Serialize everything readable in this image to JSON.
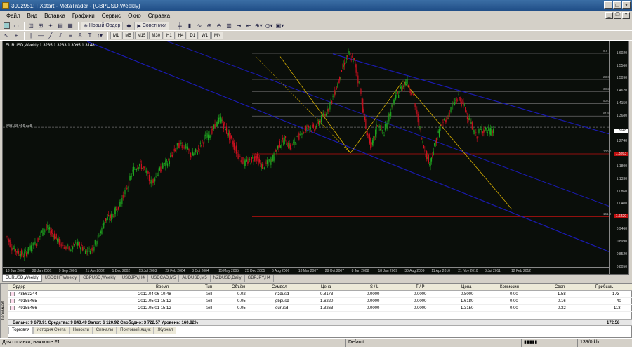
{
  "window": {
    "title": "3002951: FXstart - MetaTrader - [GBPUSD,Weekly]"
  },
  "menu": [
    "Файл",
    "Вид",
    "Вставка",
    "Графики",
    "Сервис",
    "Окно",
    "Справка"
  ],
  "toolbar": {
    "new_order": "Новый Ордер",
    "experts": "Советники"
  },
  "timeframes": [
    "M1",
    "M5",
    "M15",
    "M30",
    "H1",
    "H4",
    "D1",
    "W1",
    "MN"
  ],
  "chart": {
    "title": "EURUSD,Weekly  1.3235 1.3283 1.3095 1.3148",
    "order_label": "#49155466 sell",
    "current_price": "1.3148",
    "line_tags": [
      "1.3263",
      "1.6220"
    ],
    "fib_labels": [
      "0.0",
      "23.6",
      "38.2",
      "50.0",
      "61.8",
      "100.0",
      "161.8"
    ],
    "background": "#0a0e0a",
    "bull_color": "#1fa51f",
    "bear_color": "#d01020",
    "channel_color": "#1a1ab0",
    "fork_color": "#d9b000"
  },
  "chart_data": {
    "type": "line",
    "symbol": "EURUSD",
    "timeframe": "Weekly",
    "y_ticks": [
      "1.6020",
      "1.5560",
      "1.5090",
      "1.4620",
      "1.4150",
      "1.3680",
      "1.2740",
      "1.2270",
      "1.1800",
      "1.1330",
      "1.0860",
      "1.0400",
      "0.9930",
      "0.9460",
      "0.8990",
      "0.8520",
      "0.8050"
    ],
    "x_ticks": [
      "18 Jun 2000",
      "28 Jan 2001",
      "9 Sep 2001",
      "21 Apr 2002",
      "1 Dec 2002",
      "13 Jul 2003",
      "22 Feb 2004",
      "3 Oct 2004",
      "15 May 2005",
      "25 Dec 2005",
      "6 Aug 2006",
      "18 Mar 2007",
      "28 Oct 2007",
      "8 Jun 2008",
      "18 Jan 2009",
      "30 Aug 2009",
      "11 Apr 2010",
      "21 Nov 2010",
      "3 Jul 2011",
      "12 Feb 2012"
    ],
    "ylim": [
      0.805,
      1.602
    ],
    "series": [
      {
        "values": [
          0.92,
          0.88,
          0.86,
          0.85,
          0.87,
          0.89,
          0.93,
          0.95,
          0.93,
          0.9,
          0.88,
          0.87,
          0.89,
          0.88,
          0.86,
          0.88,
          0.92,
          0.98,
          0.99,
          1.02,
          1.06,
          1.11,
          1.17,
          1.19,
          1.16,
          1.12,
          1.15,
          1.18,
          1.2,
          1.24,
          1.27,
          1.25,
          1.22,
          1.24,
          1.28,
          1.3,
          1.33,
          1.36,
          1.31,
          1.27,
          1.22,
          1.19,
          1.2,
          1.22,
          1.18,
          1.19,
          1.21,
          1.26,
          1.28,
          1.25,
          1.28,
          1.31,
          1.33,
          1.32,
          1.35,
          1.38,
          1.42,
          1.48,
          1.55,
          1.6,
          1.57,
          1.47,
          1.32,
          1.25,
          1.34,
          1.3,
          1.37,
          1.43,
          1.47,
          1.5,
          1.45,
          1.35,
          1.25,
          1.19,
          1.27,
          1.34,
          1.36,
          1.41,
          1.44,
          1.4,
          1.34,
          1.29,
          1.32,
          1.31,
          1.31
        ]
      }
    ]
  },
  "chart_tabs": [
    "EURUSD,Weekly",
    "USDCHF,Weekly",
    "GBPUSD,Weekly",
    "USDJPY,H4",
    "USDCAD,M5",
    "AUDUSD,M5",
    "NZDUSD,Daily",
    "GBPJPY,H4"
  ],
  "terminal": {
    "side_label": "Терминал",
    "columns": [
      "Ордер",
      "Время",
      "Тип",
      "Объём",
      "Символ",
      "Цена",
      "S / L",
      "T / P",
      "Цена",
      "Комиссия",
      "Своп",
      "Прибыль"
    ],
    "rows": [
      [
        "48563244",
        "2012.04.06 10:48",
        "sell",
        "0.02",
        "nzdusd",
        "0.8173",
        "0.0000",
        "0.0000",
        "0.8000",
        "0.00",
        "-1.58",
        "173"
      ],
      [
        "49155465",
        "2012.05.01 15:12",
        "sell",
        "0.05",
        "gbpusd",
        "1.6220",
        "0.0000",
        "0.0000",
        "1.6180",
        "0.00",
        "-0.16",
        "40"
      ],
      [
        "49155466",
        "2012.05.01 15:12",
        "sell",
        "0.05",
        "eurusd",
        "1.3263",
        "0.0000",
        "0.0000",
        "1.3150",
        "0.00",
        "-0.32",
        "113"
      ]
    ],
    "balance_line": "Баланс: 9 670.91  Средства: 9 843.49  Залог: 6 120.92  Свободно: 3 722.57  Уровень: 160.82%",
    "balance_total": "172.58",
    "tabs": [
      "Торговля",
      "История Счета",
      "Новости",
      "Сигналы",
      "Почтовый ящик",
      "Журнал"
    ]
  },
  "status": {
    "help": "Для справки, нажмите F1",
    "profile": "Default",
    "traffic": "139/0 kb"
  }
}
